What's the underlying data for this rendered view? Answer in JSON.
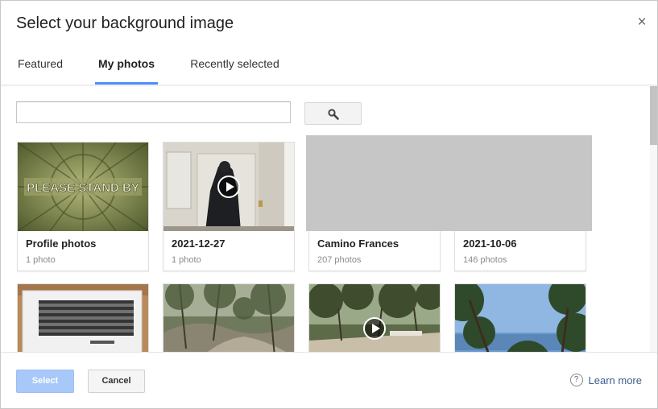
{
  "dialog": {
    "title": "Select your background image",
    "close_icon": "×"
  },
  "tabs": [
    {
      "label": "Featured",
      "active": false
    },
    {
      "label": "My photos",
      "active": true
    },
    {
      "label": "Recently selected",
      "active": false
    }
  ],
  "search": {
    "placeholder": "",
    "value": "",
    "button_icon": "search-icon"
  },
  "albums": [
    {
      "name": "Profile photos",
      "count": "1 photo",
      "video": false
    },
    {
      "name": "2021-12-27",
      "count": "1 photo",
      "video": true
    },
    {
      "name": "Camino Frances",
      "count": "207 photos",
      "video": false
    },
    {
      "name": "2021-10-06",
      "count": "146 photos",
      "video": false
    }
  ],
  "thumbnails_row2": [
    {
      "video": false
    },
    {
      "video": false
    },
    {
      "video": true
    },
    {
      "video": false
    }
  ],
  "thumbnail_texts": {
    "profile": "PLEASE STAND BY"
  },
  "footer": {
    "select_label": "Select",
    "cancel_label": "Cancel",
    "learn_more_label": "Learn more",
    "help_icon": "?"
  },
  "colors": {
    "accent": "#4d90fe",
    "select_disabled": "#a8c8f9",
    "link": "#3f5d8c"
  }
}
